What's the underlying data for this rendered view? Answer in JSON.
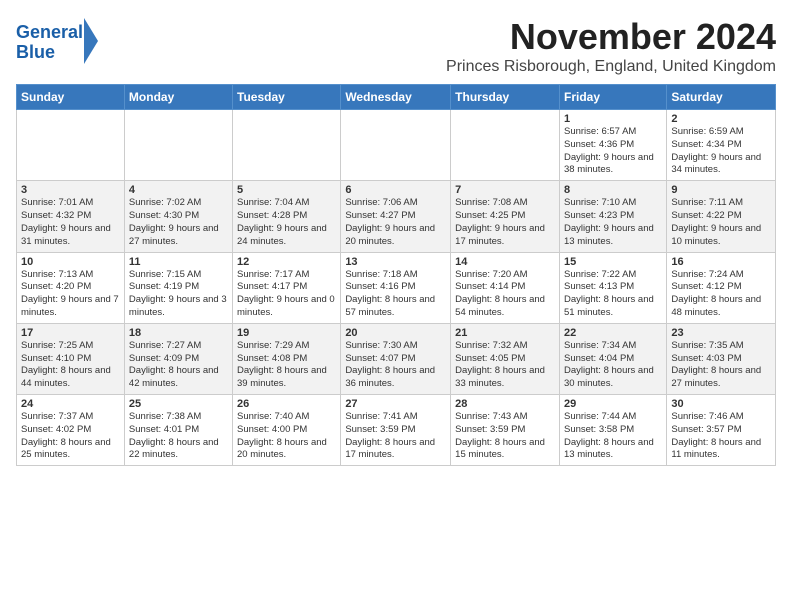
{
  "header": {
    "logo_line1": "General",
    "logo_line2": "Blue",
    "month_title": "November 2024",
    "location": "Princes Risborough, England, United Kingdom"
  },
  "weekdays": [
    "Sunday",
    "Monday",
    "Tuesday",
    "Wednesday",
    "Thursday",
    "Friday",
    "Saturday"
  ],
  "weeks": [
    [
      {
        "day": "",
        "info": ""
      },
      {
        "day": "",
        "info": ""
      },
      {
        "day": "",
        "info": ""
      },
      {
        "day": "",
        "info": ""
      },
      {
        "day": "",
        "info": ""
      },
      {
        "day": "1",
        "info": "Sunrise: 6:57 AM\nSunset: 4:36 PM\nDaylight: 9 hours and 38 minutes."
      },
      {
        "day": "2",
        "info": "Sunrise: 6:59 AM\nSunset: 4:34 PM\nDaylight: 9 hours and 34 minutes."
      }
    ],
    [
      {
        "day": "3",
        "info": "Sunrise: 7:01 AM\nSunset: 4:32 PM\nDaylight: 9 hours and 31 minutes."
      },
      {
        "day": "4",
        "info": "Sunrise: 7:02 AM\nSunset: 4:30 PM\nDaylight: 9 hours and 27 minutes."
      },
      {
        "day": "5",
        "info": "Sunrise: 7:04 AM\nSunset: 4:28 PM\nDaylight: 9 hours and 24 minutes."
      },
      {
        "day": "6",
        "info": "Sunrise: 7:06 AM\nSunset: 4:27 PM\nDaylight: 9 hours and 20 minutes."
      },
      {
        "day": "7",
        "info": "Sunrise: 7:08 AM\nSunset: 4:25 PM\nDaylight: 9 hours and 17 minutes."
      },
      {
        "day": "8",
        "info": "Sunrise: 7:10 AM\nSunset: 4:23 PM\nDaylight: 9 hours and 13 minutes."
      },
      {
        "day": "9",
        "info": "Sunrise: 7:11 AM\nSunset: 4:22 PM\nDaylight: 9 hours and 10 minutes."
      }
    ],
    [
      {
        "day": "10",
        "info": "Sunrise: 7:13 AM\nSunset: 4:20 PM\nDaylight: 9 hours and 7 minutes."
      },
      {
        "day": "11",
        "info": "Sunrise: 7:15 AM\nSunset: 4:19 PM\nDaylight: 9 hours and 3 minutes."
      },
      {
        "day": "12",
        "info": "Sunrise: 7:17 AM\nSunset: 4:17 PM\nDaylight: 9 hours and 0 minutes."
      },
      {
        "day": "13",
        "info": "Sunrise: 7:18 AM\nSunset: 4:16 PM\nDaylight: 8 hours and 57 minutes."
      },
      {
        "day": "14",
        "info": "Sunrise: 7:20 AM\nSunset: 4:14 PM\nDaylight: 8 hours and 54 minutes."
      },
      {
        "day": "15",
        "info": "Sunrise: 7:22 AM\nSunset: 4:13 PM\nDaylight: 8 hours and 51 minutes."
      },
      {
        "day": "16",
        "info": "Sunrise: 7:24 AM\nSunset: 4:12 PM\nDaylight: 8 hours and 48 minutes."
      }
    ],
    [
      {
        "day": "17",
        "info": "Sunrise: 7:25 AM\nSunset: 4:10 PM\nDaylight: 8 hours and 44 minutes."
      },
      {
        "day": "18",
        "info": "Sunrise: 7:27 AM\nSunset: 4:09 PM\nDaylight: 8 hours and 42 minutes."
      },
      {
        "day": "19",
        "info": "Sunrise: 7:29 AM\nSunset: 4:08 PM\nDaylight: 8 hours and 39 minutes."
      },
      {
        "day": "20",
        "info": "Sunrise: 7:30 AM\nSunset: 4:07 PM\nDaylight: 8 hours and 36 minutes."
      },
      {
        "day": "21",
        "info": "Sunrise: 7:32 AM\nSunset: 4:05 PM\nDaylight: 8 hours and 33 minutes."
      },
      {
        "day": "22",
        "info": "Sunrise: 7:34 AM\nSunset: 4:04 PM\nDaylight: 8 hours and 30 minutes."
      },
      {
        "day": "23",
        "info": "Sunrise: 7:35 AM\nSunset: 4:03 PM\nDaylight: 8 hours and 27 minutes."
      }
    ],
    [
      {
        "day": "24",
        "info": "Sunrise: 7:37 AM\nSunset: 4:02 PM\nDaylight: 8 hours and 25 minutes."
      },
      {
        "day": "25",
        "info": "Sunrise: 7:38 AM\nSunset: 4:01 PM\nDaylight: 8 hours and 22 minutes."
      },
      {
        "day": "26",
        "info": "Sunrise: 7:40 AM\nSunset: 4:00 PM\nDaylight: 8 hours and 20 minutes."
      },
      {
        "day": "27",
        "info": "Sunrise: 7:41 AM\nSunset: 3:59 PM\nDaylight: 8 hours and 17 minutes."
      },
      {
        "day": "28",
        "info": "Sunrise: 7:43 AM\nSunset: 3:59 PM\nDaylight: 8 hours and 15 minutes."
      },
      {
        "day": "29",
        "info": "Sunrise: 7:44 AM\nSunset: 3:58 PM\nDaylight: 8 hours and 13 minutes."
      },
      {
        "day": "30",
        "info": "Sunrise: 7:46 AM\nSunset: 3:57 PM\nDaylight: 8 hours and 11 minutes."
      }
    ]
  ]
}
